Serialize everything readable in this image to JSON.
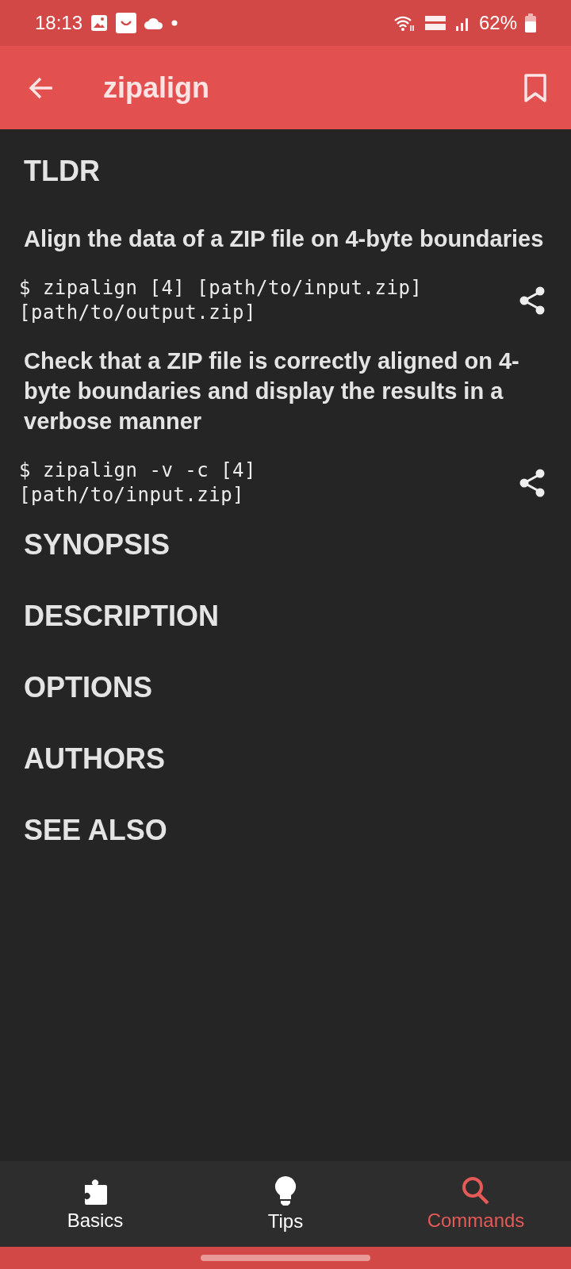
{
  "status_bar": {
    "time": "18:13",
    "battery": "62%"
  },
  "app_bar": {
    "title": "zipalign"
  },
  "content": [
    {
      "kind": "heading",
      "text": "TLDR"
    },
    {
      "kind": "description",
      "text": "Align the data of a ZIP file on 4-byte boundaries"
    },
    {
      "kind": "command",
      "text": "$ zipalign [4] [path/to/input.zip] [path/to/output.zip]"
    },
    {
      "kind": "description",
      "text": "Check that a ZIP file is correctly aligned on 4-byte boundaries and display the results in a verbose manner"
    },
    {
      "kind": "command",
      "text": "$ zipalign -v -c [4] [path/to/input.zip]"
    },
    {
      "kind": "heading",
      "text": "SYNOPSIS"
    },
    {
      "kind": "heading",
      "text": "DESCRIPTION"
    },
    {
      "kind": "heading",
      "text": "OPTIONS"
    },
    {
      "kind": "heading",
      "text": "AUTHORS"
    },
    {
      "kind": "heading",
      "text": "SEE ALSO"
    }
  ],
  "bottom_nav": [
    {
      "label": "Basics",
      "selected": false
    },
    {
      "label": "Tips",
      "selected": false
    },
    {
      "label": "Commands",
      "selected": true
    }
  ]
}
